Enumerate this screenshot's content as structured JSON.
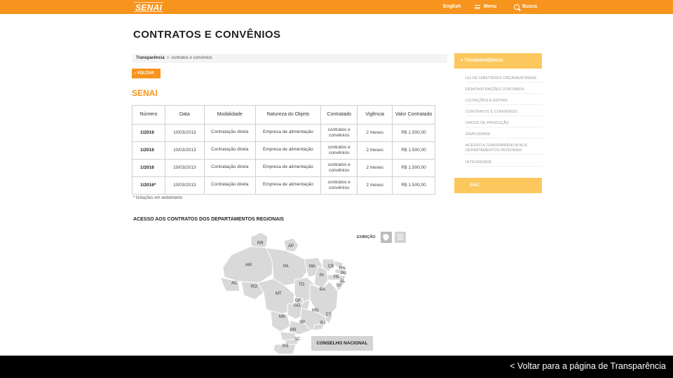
{
  "header": {
    "logo": "SENAI",
    "english": "English",
    "menu": "Menu",
    "search": "Busca",
    "menu_icon": "hamburger-icon",
    "search_icon": "magnifier-icon"
  },
  "page": {
    "title": "CONTRATOS E CONVÊNIOS",
    "breadcrumb_root": "Transparência",
    "breadcrumb_separator": ">",
    "breadcrumb_current": "contratos e convênios",
    "back_label": "VOLTAR",
    "entity_title": "SENAI"
  },
  "table": {
    "headers": [
      "Número",
      "Data",
      "Modalidade",
      "Natureza do Objeto",
      "Contratado",
      "Vigência",
      "Valor Contratado"
    ],
    "rows": [
      [
        "1/2016",
        "10/03/2013",
        "Contratação direta",
        "Empresa de alimentação",
        "contratos e convênios",
        "2 meses",
        "R$ 1.500,00"
      ],
      [
        "1/2016",
        "10/03/2013",
        "Contratação direta",
        "Empresa de alimentação",
        "contratos e convênios",
        "2 meses",
        "R$ 1.500,00"
      ],
      [
        "1/2016",
        "10/03/2013",
        "Contratação direta",
        "Empresa de alimentação",
        "contratos e convênios",
        "2 meses",
        "R$ 1.500,00"
      ],
      [
        "1/2016*",
        "10/03/2013",
        "Contratação direta",
        "Empresa de alimentação",
        "contratos e convênios",
        "2 meses",
        "R$ 1.500,00"
      ]
    ],
    "footnote": "* licitações em andamento"
  },
  "regional": {
    "title": "ACESSO AOS CONTRATOS DOS DEPARTAMENTOS REGIONAIS",
    "view_label": "EXIBIÇÃO",
    "states": [
      "RR",
      "AP",
      "AM",
      "PA",
      "MA",
      "CE",
      "RN",
      "PB",
      "PE",
      "AL",
      "SE",
      "PI",
      "AC",
      "RO",
      "TO",
      "BA",
      "MT",
      "DF",
      "GO",
      "MG",
      "ES",
      "MS",
      "SP",
      "RJ",
      "PR",
      "SC",
      "RS"
    ],
    "national_button": "CONSELHO NACIONAL"
  },
  "sidebar": {
    "heading": "TRANSPARÊNCIA",
    "items": [
      "LEI DE DIRETRIZES ORÇAMENTÁRIAS",
      "DEMONSTRAÇÕES CONTÁBEIS",
      "LICITAÇÕES E EDITAIS",
      "CONTRATOS E CONVÊNIOS",
      "DADOS DE PRODUÇÃO",
      "GRATUIDADE",
      "ACESSO A TRANSPARÊNCIA NOS DEPARTAMENTOS REGIONAIS",
      "INTEGRIDADE"
    ],
    "sac": "SAC"
  },
  "footer": {
    "back_link": "< Voltar para a página de Transparência"
  },
  "colors": {
    "brand_orange": "#f7941d",
    "sidebar_yellow": "#fcc85d",
    "map_state": "#d9d9d9"
  }
}
